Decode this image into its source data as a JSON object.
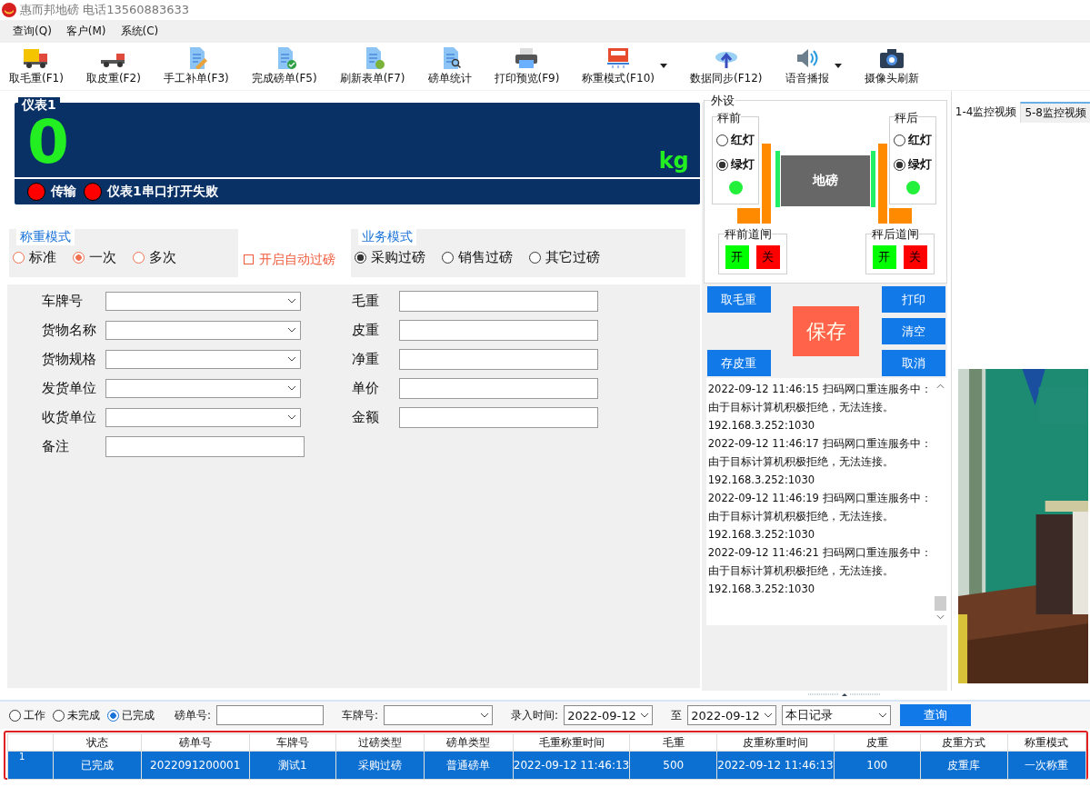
{
  "window": {
    "title": "惠而邦地磅 电话13560883633"
  },
  "menu": [
    "查询(Q)",
    "客户(M)",
    "系统(C)"
  ],
  "toolbar": [
    {
      "label": "取毛重(F1)",
      "dropdown": false
    },
    {
      "label": "取皮重(F2)",
      "dropdown": false
    },
    {
      "label": "手工补单(F3)",
      "dropdown": false
    },
    {
      "label": "完成磅单(F5)",
      "dropdown": false
    },
    {
      "label": "刷新表单(F7)",
      "dropdown": false
    },
    {
      "label": "磅单统计",
      "dropdown": false
    },
    {
      "label": "打印预览(F9)",
      "dropdown": false
    },
    {
      "label": "称重模式(F10)",
      "dropdown": true
    },
    {
      "label": "数据同步(F12)",
      "dropdown": false
    },
    {
      "label": "语音播报",
      "dropdown": true
    },
    {
      "label": "摄像头刷新",
      "dropdown": false
    }
  ],
  "meter": {
    "title": "仪表1",
    "value": "0",
    "unit": "kg",
    "indicators": [
      {
        "label": "传输",
        "ok": false
      },
      {
        "label": "仪表1串口打开失败",
        "ok": false
      }
    ]
  },
  "weighing_mode": {
    "title": "称重模式",
    "options": [
      {
        "label": "标准",
        "selected": false
      },
      {
        "label": "一次",
        "selected": true
      },
      {
        "label": "多次",
        "selected": false
      }
    ]
  },
  "auto_pass": {
    "label": "开启自动过磅",
    "checked": false
  },
  "business_mode": {
    "title": "业务模式",
    "options": [
      {
        "label": "采购过磅",
        "selected": true
      },
      {
        "label": "销售过磅",
        "selected": false
      },
      {
        "label": "其它过磅",
        "selected": false
      }
    ]
  },
  "form_left": [
    {
      "label": "车牌号",
      "kind": "select"
    },
    {
      "label": "货物名称",
      "kind": "select"
    },
    {
      "label": "货物规格",
      "kind": "select"
    },
    {
      "label": "发货单位",
      "kind": "select"
    },
    {
      "label": "收货单位",
      "kind": "select"
    },
    {
      "label": "备注",
      "kind": "text"
    }
  ],
  "form_right": [
    {
      "label": "毛重"
    },
    {
      "label": "皮重"
    },
    {
      "label": "净重"
    },
    {
      "label": "单价"
    },
    {
      "label": "金额"
    }
  ],
  "peripherals": {
    "title": "外设",
    "scale_label": "地磅",
    "sides": [
      {
        "title": "秤前",
        "lights": [
          {
            "label": "红灯",
            "selected": false
          },
          {
            "label": "绿灯",
            "selected": true
          }
        ]
      },
      {
        "title": "秤后",
        "lights": [
          {
            "label": "红灯",
            "selected": false
          },
          {
            "label": "绿灯",
            "selected": true
          }
        ]
      }
    ],
    "gates": [
      {
        "title": "秤前道闸",
        "open": "开",
        "close": "关"
      },
      {
        "title": "秤后道闸",
        "open": "开",
        "close": "关"
      }
    ]
  },
  "actions": {
    "tare_gross": "取毛重",
    "save_tare": "存皮重",
    "save": "保存",
    "print": "打印",
    "clear": "清空",
    "cancel": "取消"
  },
  "log": [
    {
      "message": "2022-09-12 11:46:15 扫码网口重连服务中：由于目标计算机积极拒绝，无法连接。",
      "address": "192.168.3.252:1030"
    },
    {
      "message": "2022-09-12 11:46:17 扫码网口重连服务中：由于目标计算机积极拒绝，无法连接。",
      "address": "192.168.3.252:1030"
    },
    {
      "message": "2022-09-12 11:46:19 扫码网口重连服务中：由于目标计算机积极拒绝，无法连接。",
      "address": "192.168.3.252:1030"
    },
    {
      "message": "2022-09-12 11:46:21 扫码网口重连服务中：由于目标计算机积极拒绝，无法连接。",
      "address": "192.168.3.252:1030"
    }
  ],
  "video_tabs": [
    {
      "label": "1-4监控视频",
      "selected": true
    },
    {
      "label": "5-8监控视频",
      "selected": false
    }
  ],
  "video": {
    "kind": "picture"
  },
  "filter": {
    "status": [
      {
        "label": "工作",
        "selected": false
      },
      {
        "label": "未完成",
        "selected": false
      },
      {
        "label": "已完成",
        "selected": true
      }
    ],
    "ticket_label": "磅单号:",
    "plate_label": "车牌号:",
    "time_label": "录入时间:",
    "date_from": "2022-09-12",
    "to_label": "至",
    "date_to": "2022-09-12",
    "range": "本日记录",
    "query": "查询"
  },
  "table": {
    "columns": [
      "状态",
      "磅单号",
      "车牌号",
      "过磅类型",
      "磅单类型",
      "毛重称重时间",
      "毛重",
      "皮重称重时间",
      "皮重",
      "皮重方式",
      "称重模式"
    ],
    "rows": [
      {
        "number": "1",
        "selected": true,
        "cells": [
          "已完成",
          "2022091200001",
          "测试1",
          "采购过磅",
          "普通磅单",
          "2022-09-12 11:46:13",
          "500",
          "2022-09-12 11:46:13",
          "100",
          "皮重库",
          "一次称重"
        ]
      }
    ]
  }
}
